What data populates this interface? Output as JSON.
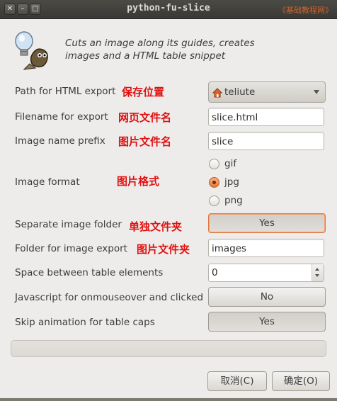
{
  "window": {
    "title": "python-fu-slice",
    "watermark": "《基础教程网》",
    "controls": [
      "close-icon",
      "minimize-icon",
      "maximize-icon"
    ]
  },
  "header": {
    "icon": "gimp-wilber-bulb-icon",
    "description": "Cuts an image along its guides, creates images and a HTML table snippet"
  },
  "fields": {
    "path": {
      "label": "Path for HTML export",
      "annotation": "保存位置",
      "value": "teliute",
      "icon": "home-folder-icon"
    },
    "filename": {
      "label": "Filename for export",
      "annotation": "网页文件名",
      "value": "slice.html"
    },
    "prefix": {
      "label": "Image name prefix",
      "annotation": "图片文件名",
      "value": "slice"
    },
    "format": {
      "label": "Image format",
      "annotation": "图片格式",
      "options": [
        "gif",
        "jpg",
        "png"
      ],
      "selected": "jpg"
    },
    "separate_folder": {
      "label": "Separate image folder",
      "annotation": "单独文件夹",
      "value": "Yes"
    },
    "image_folder": {
      "label": "Folder for image export",
      "annotation": "图片文件夹",
      "value": "images"
    },
    "space": {
      "label": "Space between table elements",
      "value": "0"
    },
    "javascript": {
      "label": "Javascript for onmouseover and clicked",
      "value": "No"
    },
    "skip_anim": {
      "label": "Skip animation for table caps",
      "value": "Yes"
    }
  },
  "progress": {
    "value": 0
  },
  "buttons": {
    "cancel": "取消(C)",
    "ok": "确定(O)"
  },
  "colors": {
    "annotation": "#e01010",
    "accent": "#e07840",
    "titlebar": "#3c3b37"
  }
}
